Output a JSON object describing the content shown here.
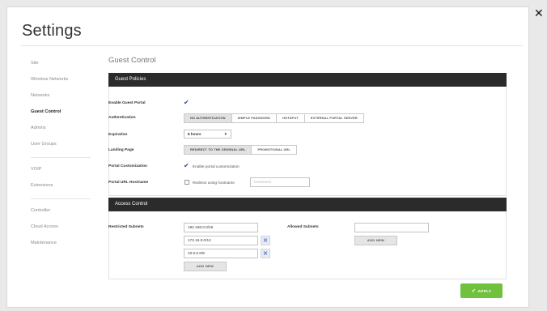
{
  "dialog": {
    "title": "Settings",
    "close_glyph": "✕"
  },
  "sidebar": {
    "groups": [
      [
        "Site",
        "Wireless Networks",
        "Networks",
        "Guest Control",
        "Admins",
        "User Groups"
      ],
      [
        "VOIP",
        "Extensions"
      ],
      [
        "Controller",
        "Cloud Access",
        "Maintenance"
      ]
    ],
    "active": "Guest Control"
  },
  "section_title": "Guest Control",
  "guest_policies": {
    "header": "Guest Policies",
    "enable_label": "Enable Guest Portal",
    "enable_checked": true,
    "auth_label": "Authentication",
    "auth_options": [
      "NO AUTHENTICATION",
      "SIMPLE PASSWORD",
      "HOTSPOT",
      "EXTERNAL PORTAL SERVER"
    ],
    "auth_selected": "NO AUTHENTICATION",
    "expiration_label": "Expiration",
    "expiration_value": "8 hours",
    "landing_label": "Landing Page",
    "landing_options": [
      "REDIRECT TO THE ORIGINAL URL",
      "PROMOTIONAL URL"
    ],
    "landing_selected": "REDIRECT TO THE ORIGINAL URL",
    "custom_label": "Portal Customization",
    "custom_checked": true,
    "custom_text": "Enable portal customization",
    "hostname_label": "Portal URL Hostname",
    "hostname_checked": false,
    "hostname_text": "Redirect using hostname",
    "hostname_placeholder": "Hostname"
  },
  "access_control": {
    "header": "Access Control",
    "restricted_label": "Restricted Subnets",
    "restricted": [
      "192.168.0.0/16",
      "172.16.0.0/12",
      "10.0.0.0/8"
    ],
    "add_new": "ADD NEW",
    "allowed_label": "Allowed Subnets",
    "allowed_value": "",
    "allowed_add_new": "ADD NEW"
  },
  "apply_label": "APPLY",
  "colors": {
    "accent_green": "#70c23e",
    "header_dark": "#2b2b2b",
    "check_blue": "#2d4a9a"
  }
}
